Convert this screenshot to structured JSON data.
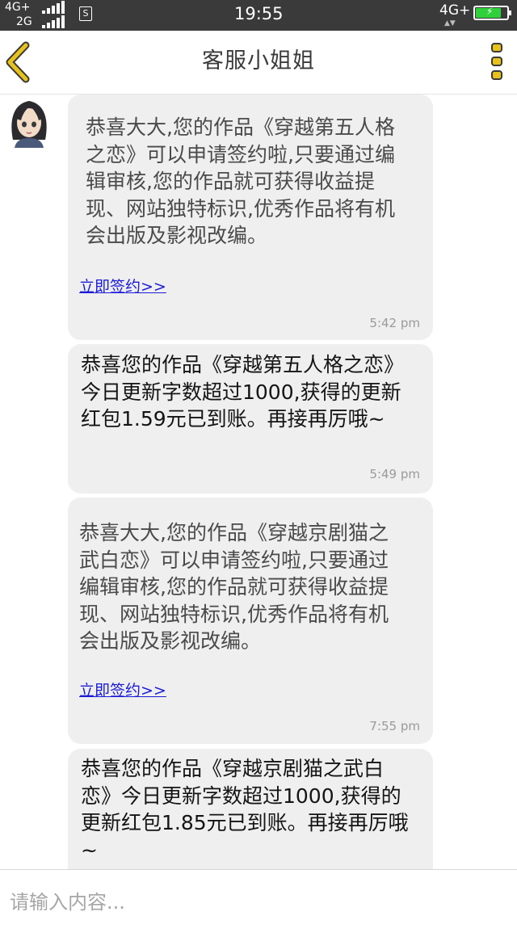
{
  "status_bar": {
    "network_top": "4G+",
    "network_bottom": "2G",
    "time": "19:55",
    "network_right": "4G+",
    "signal_icon": "signal-bars-icon",
    "sim_icon": "s-badge-icon",
    "battery_level": 0.85,
    "battery_color": "#2fd13a"
  },
  "nav": {
    "title": "客服小姐姐",
    "back_icon": "chevron-left-icon",
    "more_icon": "vertical-dots-icon",
    "accent_color": "#e8c21a"
  },
  "messages": [
    {
      "text": "恭喜大大,您的作品《穿越第五人格之恋》可以申请签约啦,只要通过编辑审核,您的作品就可获得收益提现、网站独特标识,优秀作品将有机会出版及影视改编。",
      "link": "立即签约>>",
      "time": "5:42 pm"
    },
    {
      "text": "恭喜您的作品《穿越第五人格之恋》今日更新字数超过1000,获得的更新红包1.59元已到账。再接再厉哦~",
      "time": "5:49 pm"
    },
    {
      "text": "恭喜大大,您的作品《穿越京剧猫之武白恋》可以申请签约啦,只要通过编辑审核,您的作品就可获得收益提现、网站独特标识,优秀作品将有机会出版及影视改编。",
      "link": "立即签约>>",
      "time": "7:55 pm"
    },
    {
      "text": "恭喜您的作品《穿越京剧猫之武白恋》今日更新字数超过1000,获得的更新红包1.85元已到账。再接再厉哦~"
    }
  ],
  "input": {
    "placeholder": "请输入内容..."
  },
  "colors": {
    "status_bar_bg": "#3a3a3a",
    "bubble_bg": "#efefef",
    "link": "#1a1ad8"
  }
}
